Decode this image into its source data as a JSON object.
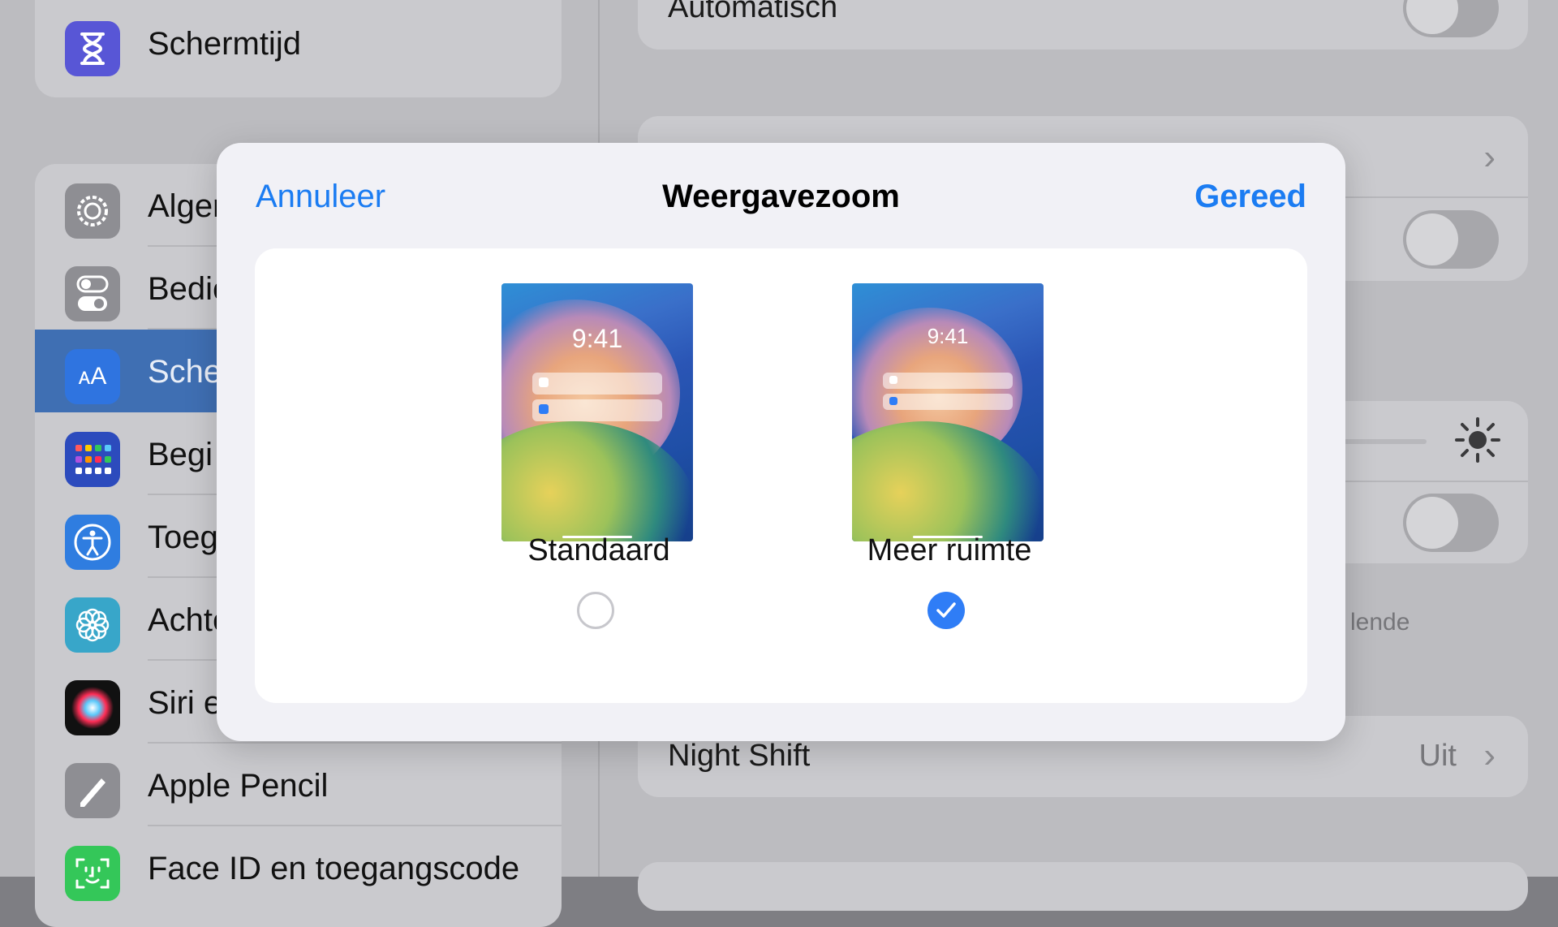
{
  "sidebar": {
    "items": [
      {
        "label": "Schermtijd",
        "icon": "hourglass-icon",
        "color": "#5856d6"
      },
      {
        "label": "Alger",
        "icon": "gear-icon",
        "color": "#8e8e93"
      },
      {
        "label": "Bedie",
        "icon": "switches-icon",
        "color": "#8e8e93"
      },
      {
        "label": "Sche",
        "icon": "text-size-icon",
        "color": "#2f74e0",
        "selected": true
      },
      {
        "label": "Begi",
        "icon": "home-screen-grid-icon",
        "color": "#2c4bbd"
      },
      {
        "label": "Toeg",
        "icon": "accessibility-icon",
        "color": "#2f7de0"
      },
      {
        "label": "Achte",
        "icon": "wallpaper-flower-icon",
        "color": "#38a6c9"
      },
      {
        "label": "Siri e",
        "icon": "siri-icon",
        "color": "#111111"
      },
      {
        "label": "Apple Pencil",
        "icon": "pencil-icon",
        "color": "#8e8e93"
      },
      {
        "label": "Face ID en toegangscode",
        "icon": "face-id-icon",
        "color": "#34c759"
      }
    ]
  },
  "background": {
    "automatisch_label": "Automatisch",
    "partial_text": "lende",
    "night_shift_label": "Night Shift",
    "night_shift_value": "Uit"
  },
  "modal": {
    "title": "Weergavezoom",
    "cancel_label": "Annuleer",
    "done_label": "Gereed",
    "options": [
      {
        "label": "Standaard",
        "time": "9:41",
        "selected": false
      },
      {
        "label": "Meer ruimte",
        "time": "9:41",
        "selected": true
      }
    ]
  },
  "colors": {
    "accent": "#1b7cf2",
    "check": "#2f7df6"
  }
}
